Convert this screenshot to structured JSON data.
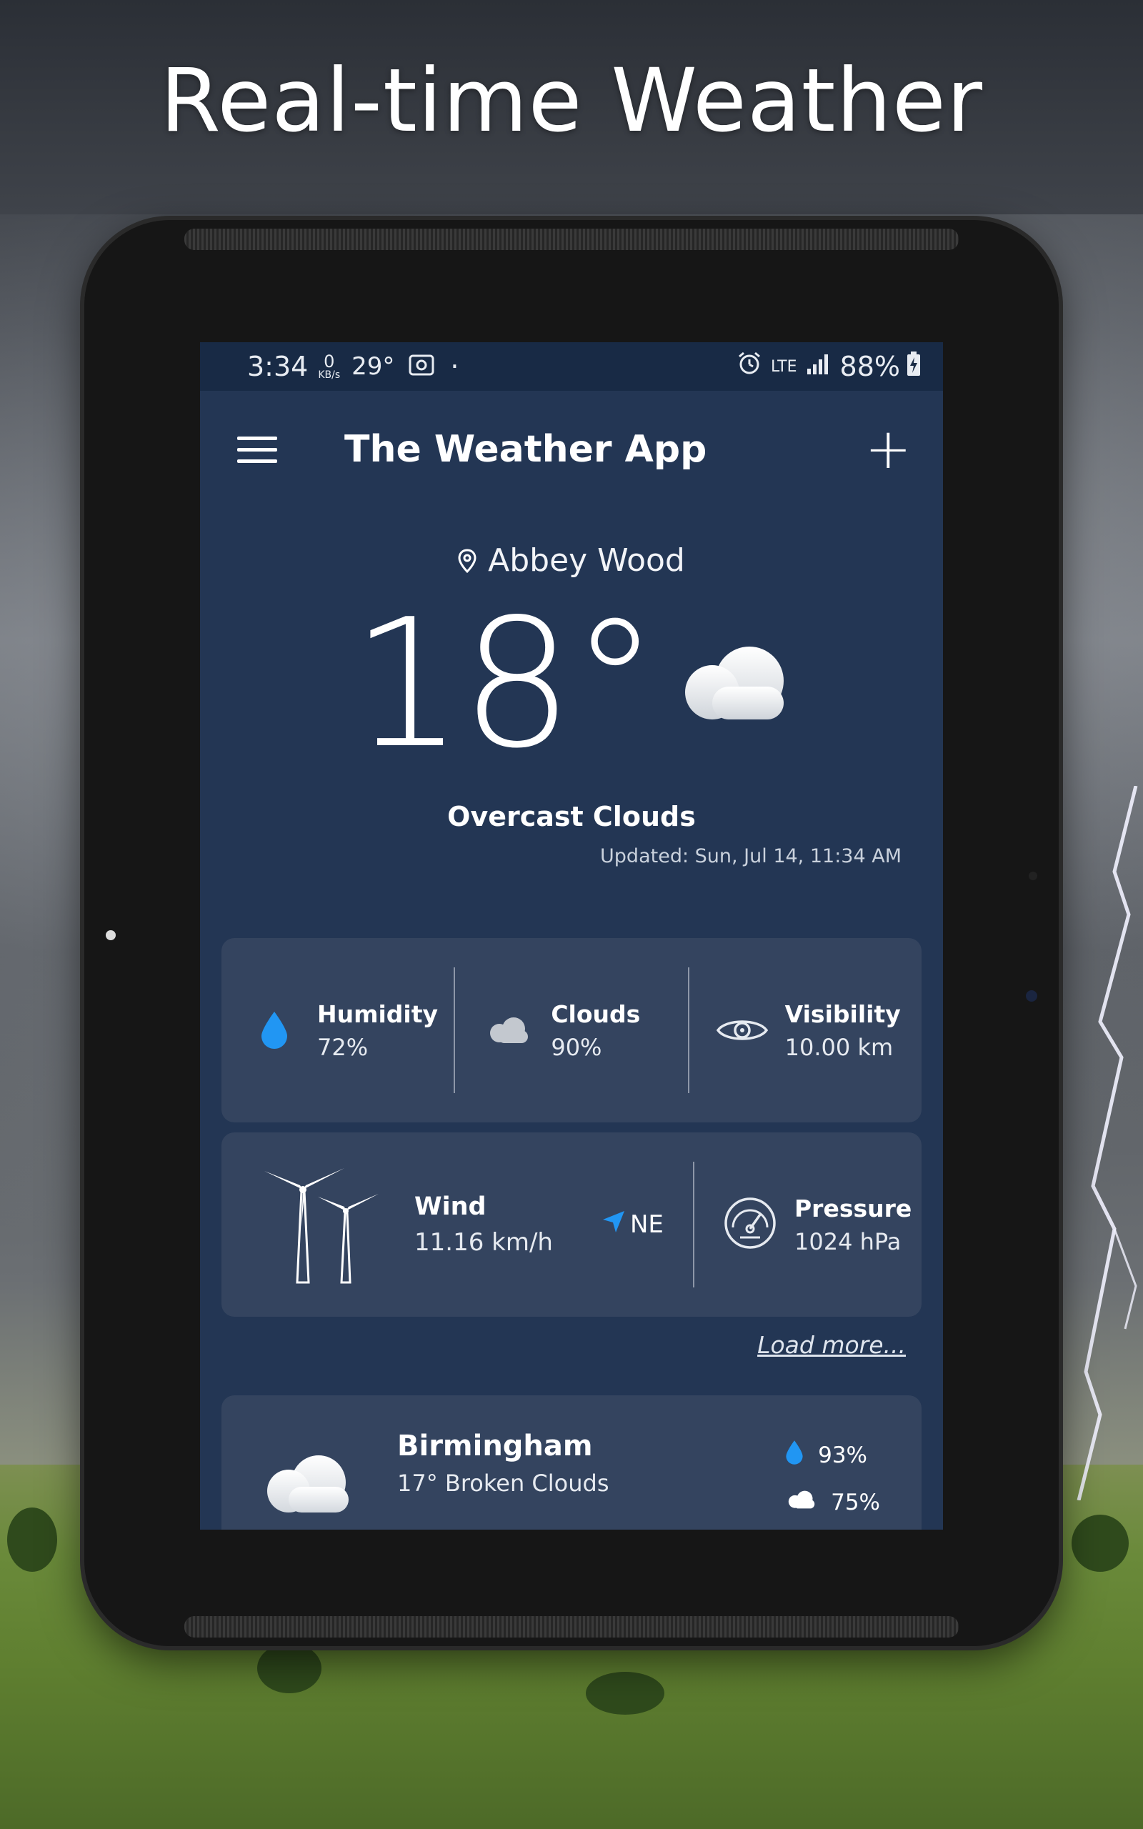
{
  "headline": "Real-time Weather",
  "status_bar": {
    "time": "3:34",
    "data_rate_value": "0",
    "data_rate_unit": "KB/s",
    "temp": "29°",
    "dot": "·",
    "network": "LTE",
    "battery": "88%"
  },
  "toolbar": {
    "title": "The Weather App"
  },
  "current": {
    "location": "Abbey Wood",
    "temperature": "18°",
    "condition": "Overcast Clouds",
    "updated": "Updated: Sun, Jul 14, 11:34 AM"
  },
  "metrics": {
    "humidity": {
      "label": "Humidity",
      "value": "72%"
    },
    "clouds": {
      "label": "Clouds",
      "value": "90%"
    },
    "visibility": {
      "label": "Visibility",
      "value": "10.00 km"
    }
  },
  "wind": {
    "label": "Wind",
    "value": "11.16 km/h",
    "direction": "NE"
  },
  "pressure": {
    "label": "Pressure",
    "value": "1024 hPa"
  },
  "load_more": "Load more...",
  "saved_city": {
    "name": "Birmingham",
    "desc": "17° Broken Clouds",
    "humidity": "93%",
    "clouds": "75%"
  },
  "colors": {
    "screen_bg": "#233654",
    "card_bg": "#34445f",
    "accent_blue": "#2196f3"
  }
}
